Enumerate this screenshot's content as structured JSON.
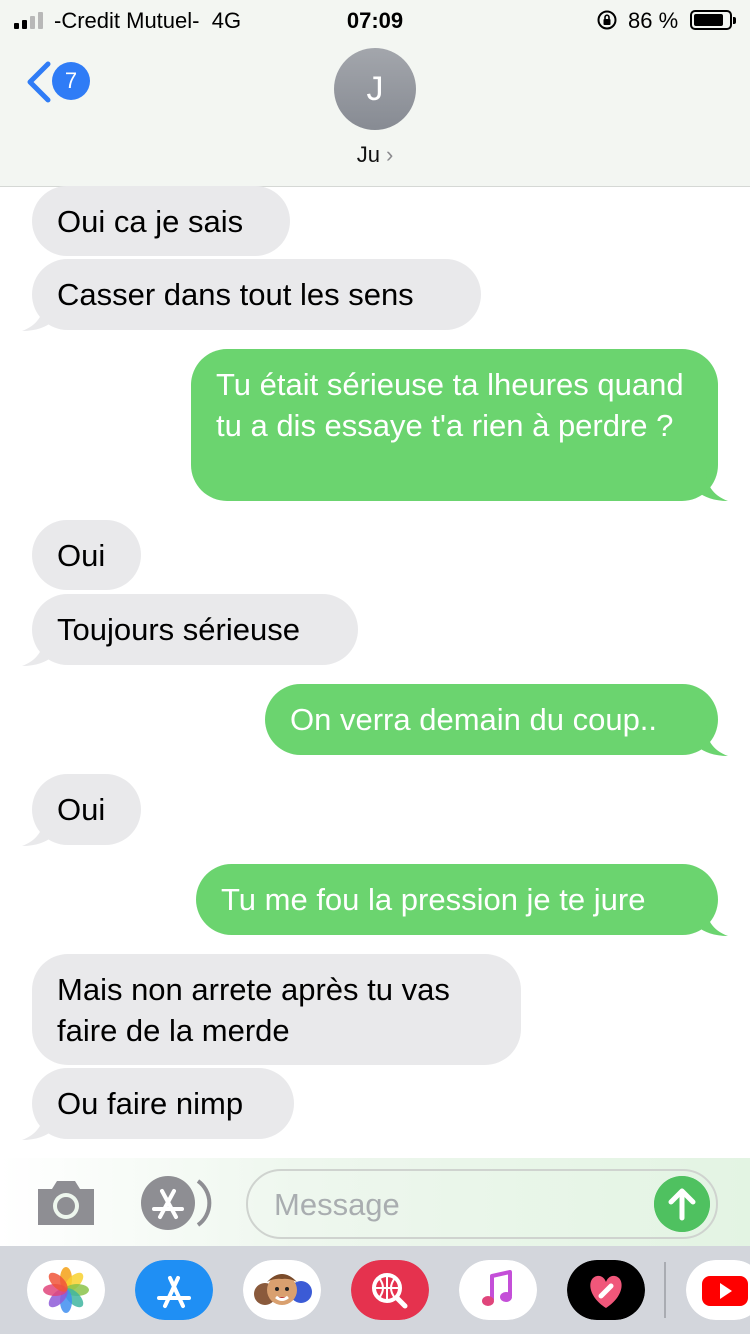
{
  "status_bar": {
    "carrier": "-Credit Mutuel-",
    "network": "4G",
    "time": "07:09",
    "battery": "86 %",
    "battery_level": 0.86
  },
  "header": {
    "back_badge": "7",
    "avatar_initial": "J",
    "contact_name": "Ju"
  },
  "messages": [
    {
      "direction": "incoming",
      "text": "Oui ca je sais"
    },
    {
      "direction": "incoming",
      "text": "Casser dans tout les sens"
    },
    {
      "direction": "outgoing",
      "text": "Tu était sérieuse ta lheures quand tu a dis essaye t'a rien à perdre ?"
    },
    {
      "direction": "incoming",
      "text": "Oui"
    },
    {
      "direction": "incoming",
      "text": "Toujours sérieuse"
    },
    {
      "direction": "outgoing",
      "text": "On verra demain du coup.."
    },
    {
      "direction": "incoming",
      "text": "Oui"
    },
    {
      "direction": "outgoing",
      "text": "Tu me fou la pression je te jure"
    },
    {
      "direction": "incoming",
      "text": "Mais non arrete après tu vas faire de la merde"
    },
    {
      "direction": "incoming",
      "text": "Ou faire nimp"
    }
  ],
  "composer": {
    "placeholder": "Message"
  },
  "app_drawer": [
    "photos-icon",
    "app-store-icon",
    "memoji-icon",
    "web-search-icon",
    "music-icon",
    "digital-touch-icon",
    "youtube-icon"
  ],
  "colors": {
    "outgoing_bubble": "#6bd46f",
    "incoming_bubble": "#e9e9eb",
    "accent_blue": "#2f7cf6",
    "send_button": "#4fc160"
  }
}
